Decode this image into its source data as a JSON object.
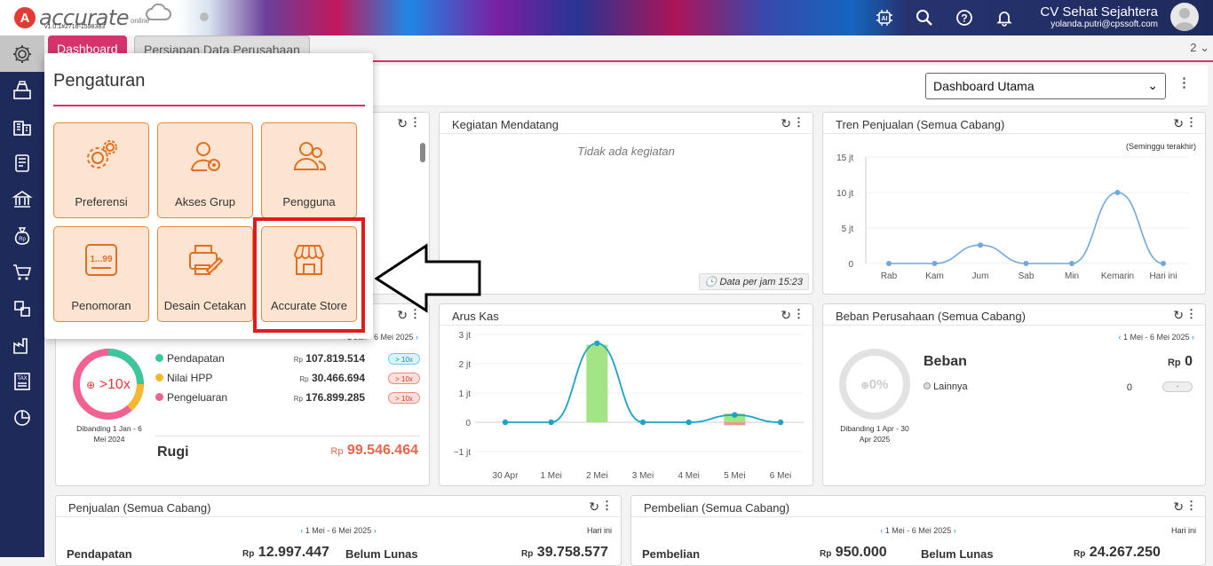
{
  "header": {
    "logo_text": "accurate",
    "logo_sub": "online",
    "version": "v1.0.1#2716-1598383",
    "company_name": "CV Sehat Sejahtera",
    "user_email": "yolanda.putri@cpssoft.com"
  },
  "tabs": {
    "dashboard": "Dashboard",
    "persiapan": "Persiapan Data Perusahaan",
    "count": "2"
  },
  "dashboard_select": {
    "value": "Dashboard Utama"
  },
  "pengaturan": {
    "title": "Pengaturan",
    "tiles": [
      {
        "label": "Preferensi",
        "icon": "gears-icon"
      },
      {
        "label": "Akses Grup",
        "icon": "user-key-icon"
      },
      {
        "label": "Pengguna",
        "icon": "users-icon"
      },
      {
        "label": "Penomoran",
        "icon": "numbering-icon"
      },
      {
        "label": "Desain Cetakan",
        "icon": "print-design-icon"
      },
      {
        "label": "Accurate Store",
        "icon": "store-icon"
      }
    ]
  },
  "kegiatan": {
    "title": "Kegiatan Mendatang",
    "empty": "Tidak ada kegiatan",
    "footer": "Data per jam 15:23"
  },
  "tren": {
    "title": "Tren Penjualan (Semua Cabang)",
    "note": "(Seminggu terakhir)"
  },
  "aruskas": {
    "title": "Arus Kas"
  },
  "laba": {
    "range": "1 Jan - 6 Mei 2025",
    "badge": ">10x",
    "compare": "Dibanding 1 Jan - 6 Mei 2024",
    "rows": [
      {
        "label": "Pendapatan",
        "rp": "Rp",
        "value": "107.819.514",
        "tag": "> 10x",
        "color": "#3cc69b"
      },
      {
        "label": "Nilai HPP",
        "rp": "Rp",
        "value": "30.466.694",
        "tag": "> 10x",
        "color": "#f5b82e"
      },
      {
        "label": "Pengeluaran",
        "rp": "Rp",
        "value": "176.899.285",
        "tag": "> 10x",
        "color": "#f06292"
      }
    ],
    "result_label": "Rugi",
    "result_rp": "Rp",
    "result_value": "99.546.464"
  },
  "beban": {
    "title": "Beban Perusahaan (Semua Cabang)",
    "range": "1 Mei - 6 Mei 2025",
    "donut": "0%",
    "compare": "Dibanding 1 Apr - 30 Apr 2025",
    "heading": "Beban",
    "heading_rp": "Rp",
    "heading_value": "0",
    "item_label": "Lainnya",
    "item_value": "0",
    "item_tag": "-"
  },
  "penjualan": {
    "title": "Penjualan (Semua Cabang)",
    "range": "1 Mei - 6 Mei 2025",
    "period": "Hari ini",
    "label1": "Pendapatan",
    "rp1": "Rp",
    "value1": "12.997.447",
    "label2": "Belum Lunas",
    "rp2": "Rp",
    "value2": "39.758.577"
  },
  "pembelian": {
    "title": "Pembelian (Semua Cabang)",
    "range": "1 Mei - 6 Mei 2025",
    "period": "Hari ini",
    "label1": "Pembelian",
    "rp1": "Rp",
    "value1": "950.000",
    "label2": "Belum Lunas",
    "rp2": "Rp",
    "value2": "24.267.250"
  },
  "chart_data": [
    {
      "type": "line",
      "title": "Tren Penjualan (Semua Cabang)",
      "categories": [
        "Rab",
        "Kam",
        "Jum",
        "Sab",
        "Min",
        "Kemarin",
        "Hari ini"
      ],
      "y_ticks": [
        "15 jt",
        "10 jt",
        "5 jt",
        "0"
      ],
      "values": [
        0,
        0,
        2.6,
        0,
        0,
        10,
        0
      ],
      "ylim": [
        0,
        15
      ],
      "color": "#6fa8dc"
    },
    {
      "type": "line",
      "title": "Arus Kas",
      "categories": [
        "30 Apr",
        "1 Mei",
        "2 Mei",
        "3 Mei",
        "4 Mei",
        "5 Mei",
        "6 Mei"
      ],
      "y_ticks": [
        "3 jt",
        "2 jt",
        "1 jt",
        "0",
        "−1 jt"
      ],
      "values": [
        0,
        0,
        2.7,
        0,
        0,
        0.25,
        0
      ],
      "bars_in": [
        0,
        0,
        2.65,
        0,
        0,
        0.3,
        0
      ],
      "bars_out": [
        0,
        0,
        0,
        0,
        0,
        -0.1,
        0
      ],
      "ylim": [
        -1,
        3
      ],
      "color": "#1ca3c9"
    }
  ]
}
